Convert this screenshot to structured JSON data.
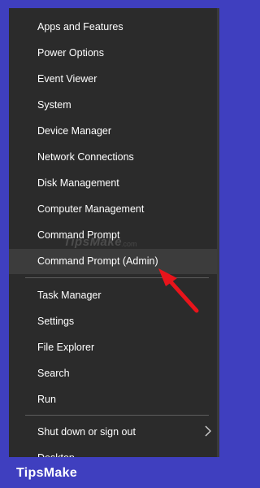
{
  "menu": {
    "items": [
      {
        "label": "Apps and Features"
      },
      {
        "label": "Power Options"
      },
      {
        "label": "Event Viewer"
      },
      {
        "label": "System"
      },
      {
        "label": "Device Manager"
      },
      {
        "label": "Network Connections"
      },
      {
        "label": "Disk Management"
      },
      {
        "label": "Computer Management"
      },
      {
        "label": "Command Prompt"
      },
      {
        "label": "Command Prompt (Admin)"
      },
      {
        "label": "Task Manager"
      },
      {
        "label": "Settings"
      },
      {
        "label": "File Explorer"
      },
      {
        "label": "Search"
      },
      {
        "label": "Run"
      },
      {
        "label": "Shut down or sign out"
      },
      {
        "label": "Desktop"
      }
    ],
    "submenu_icon": "chevron-right-icon",
    "highlighted_item": "Command Prompt (Admin)"
  },
  "watermark": {
    "text": "TipsMake",
    "suffix": ".com"
  },
  "annotation": {
    "icon": "red-arrow-icon",
    "color": "#e8141b"
  },
  "footer": {
    "brand": "TipsMake"
  },
  "colors": {
    "background": "#3f3fbf",
    "menu_bg": "#2b2b2b",
    "highlight": "#3c3c3c",
    "text": "#ffffff"
  }
}
